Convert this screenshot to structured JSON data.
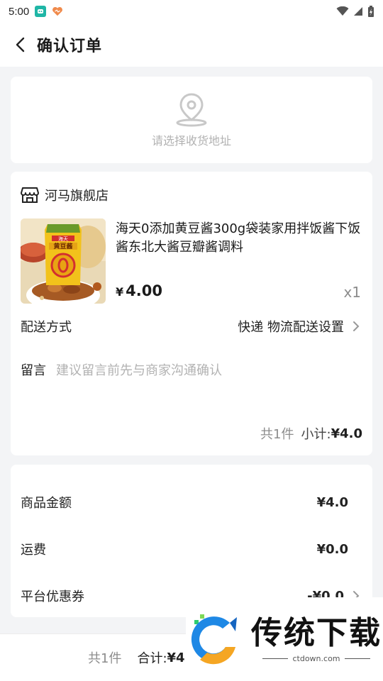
{
  "status_bar": {
    "time": "5:00"
  },
  "nav": {
    "title": "确认订单"
  },
  "address": {
    "placeholder": "请选择收货地址"
  },
  "order": {
    "store_name": "河马旗舰店",
    "product": {
      "title": "海天0添加黄豆酱300g袋装家用拌饭酱下饭酱东北大酱豆瓣酱调料",
      "currency": "¥",
      "price": "4.00",
      "quantity": "x1",
      "package_text": "黄豆酱",
      "brand_text": "海天"
    },
    "delivery": {
      "label": "配送方式",
      "value": "快递 物流配送设置"
    },
    "message": {
      "label": "留言",
      "placeholder": "建议留言前先与商家沟通确认"
    },
    "subtotal": {
      "count": "共1件",
      "label": "小计:",
      "value": "¥4.0"
    }
  },
  "summary": {
    "goods_label": "商品金额",
    "goods_value": "¥4.0",
    "shipping_label": "运费",
    "shipping_value": "¥0.0",
    "coupon_label": "平台优惠券",
    "coupon_value": "-¥0.0"
  },
  "bottom": {
    "count": "共1件",
    "total_label": "合计:",
    "total_value": "¥4"
  },
  "watermark": {
    "title": "传统下载",
    "url": "ctdown.com"
  },
  "colors": {
    "accent_teal": "#1fb6a6",
    "product_yellow": "#f2c21b",
    "brand_red": "#d32f2f"
  }
}
